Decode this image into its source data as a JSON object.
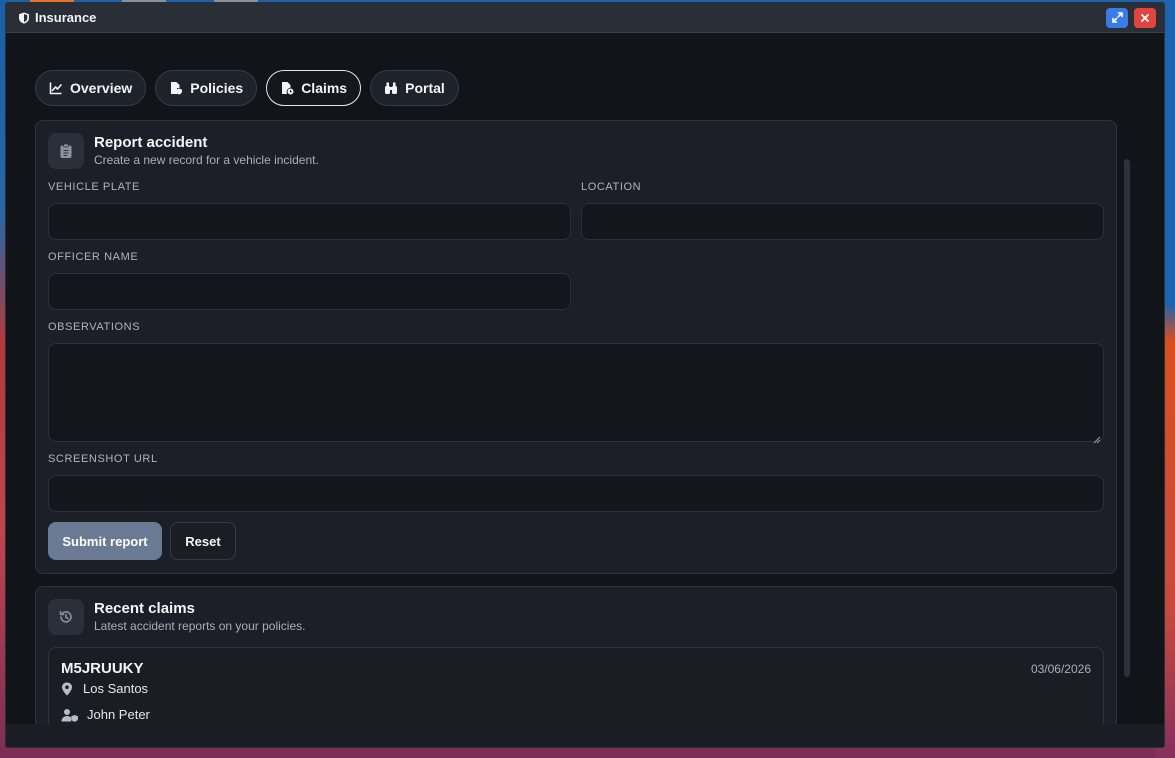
{
  "window": {
    "title": "Insurance"
  },
  "tabs": [
    {
      "label": "Overview",
      "icon": "chart-line-icon"
    },
    {
      "label": "Policies",
      "icon": "file-shield-icon"
    },
    {
      "label": "Claims",
      "icon": "file-clock-icon",
      "active": true
    },
    {
      "label": "Portal",
      "icon": "binoculars-icon"
    }
  ],
  "report": {
    "title": "Report accident",
    "subtitle": "Create a new record for a vehicle incident.",
    "fields": {
      "vehicle_plate": {
        "label": "VEHICLE PLATE",
        "value": ""
      },
      "location": {
        "label": "LOCATION",
        "value": ""
      },
      "officer_name": {
        "label": "OFFICER NAME",
        "value": ""
      },
      "observations": {
        "label": "OBSERVATIONS",
        "value": ""
      },
      "screenshot_url": {
        "label": "SCREENSHOT URL",
        "value": ""
      }
    },
    "submit_label": "Submit report",
    "reset_label": "Reset"
  },
  "recent": {
    "title": "Recent claims",
    "subtitle": "Latest accident reports on your policies.",
    "claims": [
      {
        "plate": "M5JRUUKY",
        "date": "03/06/2026",
        "location": "Los Santos",
        "officer": "John Peter"
      }
    ]
  },
  "colors": {
    "accent_submit": "#6b7a93",
    "expand_button": "#3b7be8",
    "close_button": "#e0463f"
  }
}
